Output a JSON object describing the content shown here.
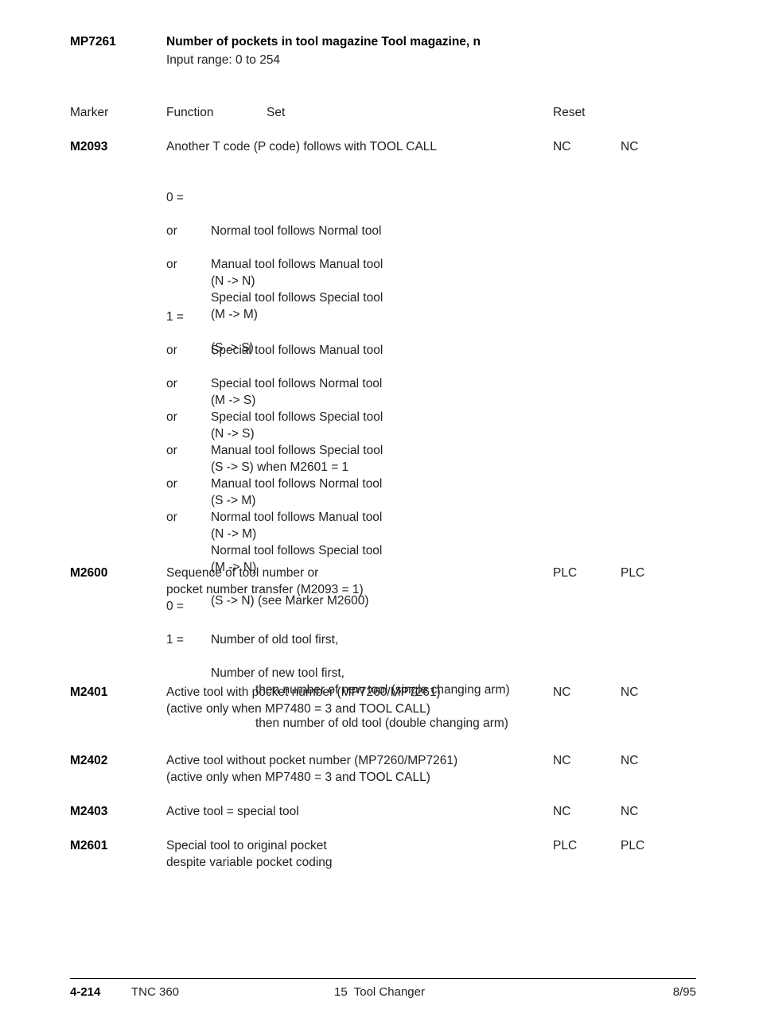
{
  "parameter": {
    "code": "MP7261",
    "title": "Number of pockets in tool magazine Tool magazine, n",
    "subtitle": "Input range: 0 to 254"
  },
  "table_header": {
    "marker": "Marker",
    "function": "Function",
    "set": "Set",
    "reset": "Reset"
  },
  "markers": {
    "m2093": {
      "name": "M2093",
      "function": "Another T code (P code) follows with TOOL CALL",
      "set": "NC",
      "reset": "NC",
      "group_zero": [
        {
          "key": "0 =",
          "desc": "Normal tool follows Normal tool",
          "code": "(N -> N)"
        },
        {
          "key": "or",
          "desc": "Manual tool follows Manual tool",
          "code": "(M -> M)"
        },
        {
          "key": "or",
          "desc": "Special tool follows Special tool",
          "code": "(S -> S)"
        }
      ],
      "group_one": [
        {
          "key": "1 =",
          "desc": "Special tool follows Manual tool",
          "code": "(M -> S)"
        },
        {
          "key": "or",
          "desc": "Special tool follows Normal tool",
          "code": "(N -> S)"
        },
        {
          "key": "or",
          "desc": "Special tool follows Special tool",
          "code": "(S -> S) when M2601 = 1"
        },
        {
          "key": "or",
          "desc": "Manual tool follows Special tool",
          "code": "(S -> M)"
        },
        {
          "key": "or",
          "desc": "Manual tool follows Normal tool",
          "code": "(N -> M)"
        },
        {
          "key": "or",
          "desc": "Normal tool follows Manual tool",
          "code": "(M -> N)"
        },
        {
          "key": "or",
          "desc": "Normal tool follows Special tool",
          "code": "(S -> N) (see Marker M2600)"
        }
      ]
    },
    "m2600": {
      "name": "M2600",
      "function_line1": "Sequence of tool number or",
      "function_line2": "pocket number transfer (M2093 = 1)",
      "set": "PLC",
      "reset": "PLC",
      "options": [
        {
          "key": "0 =",
          "desc": "Number of old tool first,",
          "code": "then number of new tool (single changing arm)"
        },
        {
          "key": "1 =",
          "desc": "Number of new tool first,",
          "code": "then number of old tool (double changing arm)"
        }
      ]
    },
    "m2401": {
      "name": "M2401",
      "function_line1": "Active tool with pocket number (MP7260/MP7261)",
      "function_line2": "(active only when MP7480 = 3 and TOOL CALL)",
      "set": "NC",
      "reset": "NC"
    },
    "m2402": {
      "name": "M2402",
      "function_line1": "Active tool without pocket number (MP7260/MP7261)",
      "function_line2": "(active only when MP7480 = 3 and TOOL CALL)",
      "set": "NC",
      "reset": "NC"
    },
    "m2403": {
      "name": "M2403",
      "function_line1": "Active tool = special tool",
      "function_line2": "",
      "set": "NC",
      "reset": "NC"
    },
    "m2601": {
      "name": "M2601",
      "function_line1": "Special tool to original pocket",
      "function_line2": "despite variable pocket coding",
      "set": "PLC",
      "reset": "PLC"
    }
  },
  "footer": {
    "page_number": "4-214",
    "model": "TNC 360",
    "chapter": "15  Tool Changer",
    "date": "8/95"
  }
}
